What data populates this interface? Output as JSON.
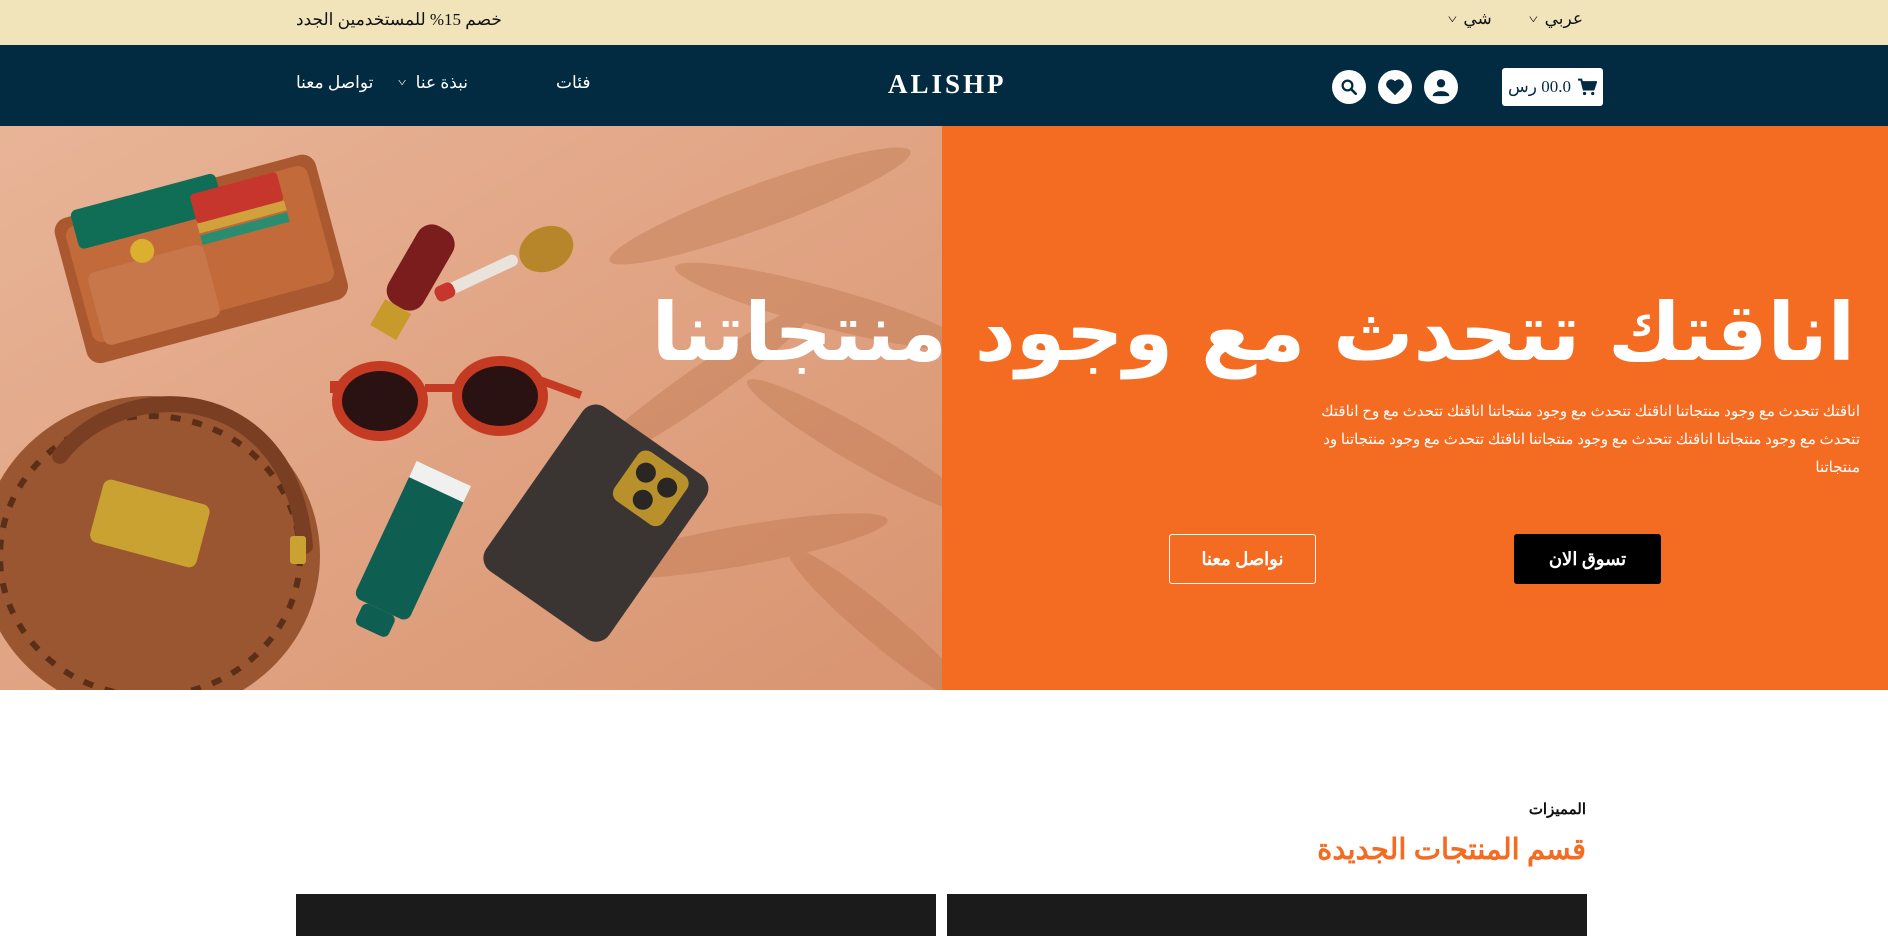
{
  "topbar": {
    "promo": "خصم 15% للمستخدمين الجدد",
    "language": "عربي",
    "currency": "شي"
  },
  "nav": {
    "logo": "ALISHP",
    "links": [
      {
        "label": "تواصل معنا"
      },
      {
        "label": "نبذة عنا"
      },
      {
        "label": "فئات"
      }
    ],
    "cart_total": "00.0 رس",
    "colors": {
      "bar": "#022a40",
      "accent": "#f36c21"
    }
  },
  "hero": {
    "title": "اناقتك تتحدث مع وجود منتجاتنا",
    "description": "اناقتك تتحدث مع وجود منتجاتنا اناقتك تتحدث مع وجود منتجاتنا اناقتك تتحدث مع وح اناقتك تتحدث مع وجود منتجاتنا اناقتك تتحدث مع وجود منتجاتنا اناقتك تتحدث مع وجود منتجاتنا ود منتجاتنا",
    "shop_button": "تسوق الان",
    "contact_button": "نواصل معنا"
  },
  "section": {
    "eyebrow": "المميزات",
    "title": "قسم المنتجات الجديدة"
  }
}
